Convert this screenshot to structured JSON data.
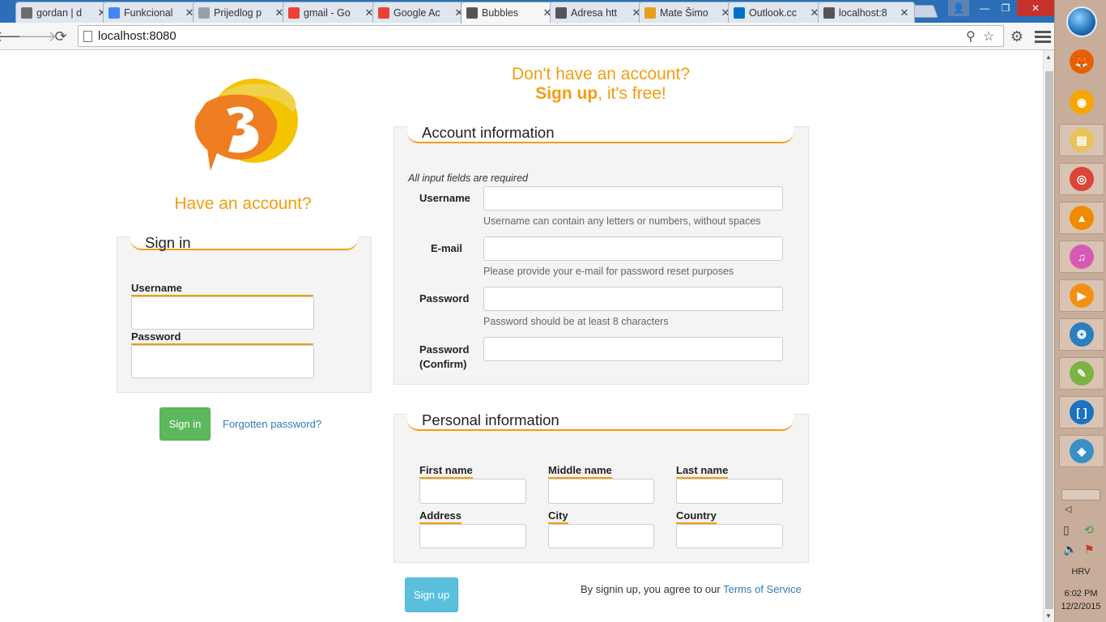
{
  "browser": {
    "tabs": [
      {
        "title": "gordan | d",
        "icon": "hash-icon",
        "color": "#6d6d6d"
      },
      {
        "title": "Funkcional",
        "icon": "docs-icon",
        "color": "#4285f4"
      },
      {
        "title": "Prijedlog p",
        "icon": "page-icon",
        "color": "#9aa0a6"
      },
      {
        "title": "gmail - Go",
        "icon": "google-icon",
        "color": "#ea4335"
      },
      {
        "title": "Google Ac",
        "icon": "google-icon",
        "color": "#ea4335"
      },
      {
        "title": "Bubbles",
        "icon": "bubbles-icon",
        "color": "#555555",
        "active": true
      },
      {
        "title": "Adresa htt",
        "icon": "bubbles-icon",
        "color": "#555555"
      },
      {
        "title": "Mate Šimo",
        "icon": "mail-icon",
        "color": "#e3a21a"
      },
      {
        "title": "Outlook.cc",
        "icon": "outlook-icon",
        "color": "#0072c6"
      },
      {
        "title": "localhost:8",
        "icon": "bubbles-icon",
        "color": "#555555"
      }
    ],
    "url": "localhost:8080",
    "back_glyph": "🡐",
    "forward_glyph": "🡒",
    "reload_glyph": "⟳",
    "close_glyph": "✕",
    "min_glyph": "—",
    "max_glyph": "❐",
    "profile_glyph": "👤",
    "tab_close_glyph": "✕",
    "zoom_glyph": "⚲",
    "star_glyph": "☆",
    "ext_glyph": "⚙"
  },
  "brand": {
    "accent": "#f39c12",
    "signin_green": "#5cb85c",
    "signup_blue": "#5bc0de",
    "link_blue": "#337ab7"
  },
  "signin": {
    "heading": "Have an account?",
    "panel_title": "Sign in",
    "username_label": "Username",
    "password_label": "Password",
    "username_value": "",
    "password_value": "",
    "submit_label": "Sign in",
    "forgot_label": "Forgotten password?"
  },
  "signup": {
    "heading_line1": "Don't have an account?",
    "heading_bold": "Sign up",
    "heading_rest": ", it's free!",
    "account": {
      "panel_title": "Account information",
      "required_note": "All input fields are required",
      "username_label": "Username",
      "username_help": "Username can contain any letters or numbers, without spaces",
      "email_label": "E-mail",
      "email_help": "Please provide your e-mail for password reset purposes",
      "password_label": "Password",
      "password_help": "Password should be at least 8 characters",
      "confirm_label_1": "Password",
      "confirm_label_2": "(Confirm)"
    },
    "personal": {
      "panel_title": "Personal information",
      "first_name_label": "First name",
      "middle_name_label": "Middle name",
      "last_name_label": "Last name",
      "address_label": "Address",
      "city_label": "City",
      "country_label": "Country"
    },
    "submit_label": "Sign up",
    "terms_prefix": "By signin up, you agree to our ",
    "terms_link": "Terms of Service"
  },
  "taskbar": {
    "apps": [
      {
        "name": "firefox-icon",
        "color": "#e66000",
        "glyph": "🦊"
      },
      {
        "name": "vlc-like-icon",
        "color": "#f7a600",
        "glyph": "◉"
      },
      {
        "name": "file-explorer-icon",
        "color": "#e8c25a",
        "glyph": "▤"
      },
      {
        "name": "chrome-icon",
        "color": "#db4437",
        "glyph": "◎"
      },
      {
        "name": "vlc-icon",
        "color": "#f08a00",
        "glyph": "▲"
      },
      {
        "name": "itunes-icon",
        "color": "#d65ab5",
        "glyph": "♫"
      },
      {
        "name": "media-player-icon",
        "color": "#f29111",
        "glyph": "▶"
      },
      {
        "name": "sourcetree-icon",
        "color": "#2a7fbf",
        "glyph": "❂"
      },
      {
        "name": "notepad-plus-icon",
        "color": "#7cb342",
        "glyph": "✎"
      },
      {
        "name": "brackets-icon",
        "color": "#1b72c4",
        "glyph": "[ ]"
      },
      {
        "name": "mysql-installer-icon",
        "color": "#3a8fc7",
        "glyph": "◈"
      }
    ],
    "language": "HRV",
    "time": "6:02 PM",
    "date": "12/2/2015"
  }
}
